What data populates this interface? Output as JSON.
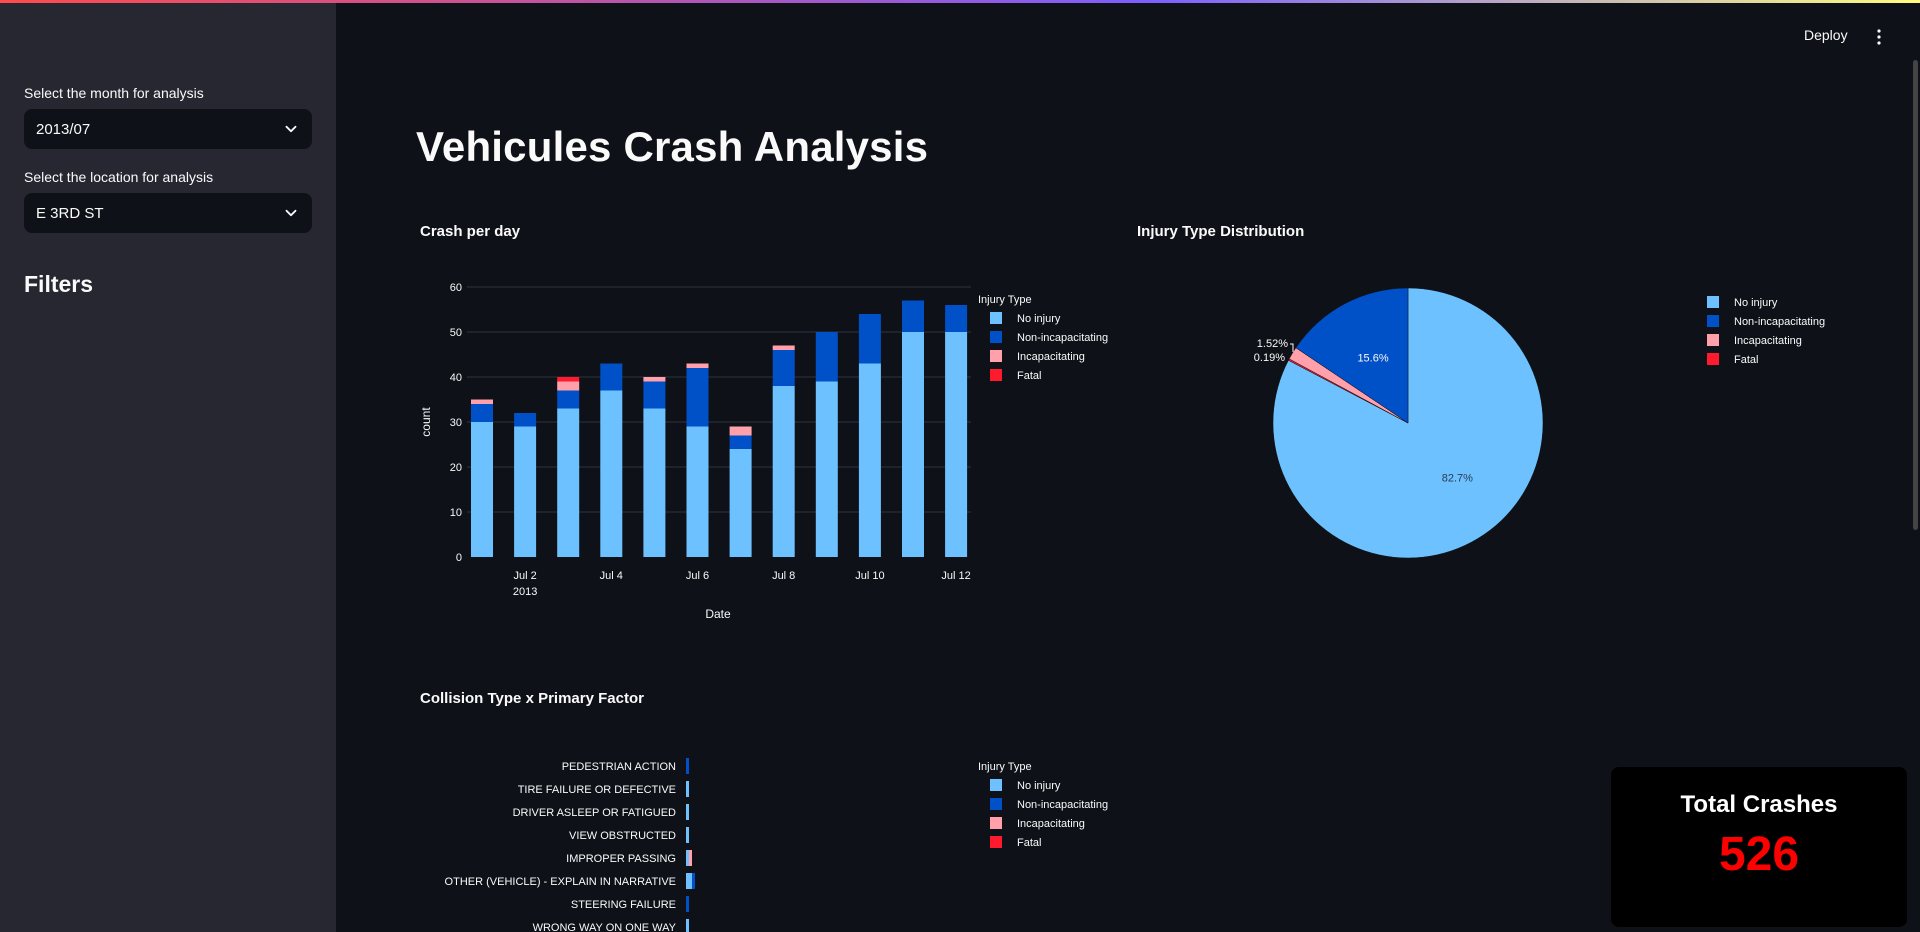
{
  "sidebar": {
    "month_label": "Select the month for analysis",
    "month_value": "2013/07",
    "location_label": "Select the location for analysis",
    "location_value": "E 3RD ST",
    "filters_heading": "Filters"
  },
  "header": {
    "deploy_label": "Deploy"
  },
  "main": {
    "title": "Vehicules Crash Analysis"
  },
  "colors": {
    "no_injury": "#6ec1ff",
    "non_incapacitating": "#0050c8",
    "incapacitating": "#ffa0aa",
    "fatal": "#ff1a2e",
    "total_value": "#ff0000"
  },
  "legend": {
    "title": "Injury Type",
    "items": [
      "No injury",
      "Non-incapacitating",
      "Incapacitating",
      "Fatal"
    ]
  },
  "chart_data": [
    {
      "type": "bar",
      "title": "Crash per day",
      "xlabel": "Date",
      "ylabel": "count",
      "ylim": [
        0,
        60
      ],
      "yticks": [
        0,
        10,
        20,
        30,
        40,
        50,
        60
      ],
      "xticks": [
        {
          "label": "Jul 2",
          "sub": "2013",
          "at": 2
        },
        {
          "label": "Jul 4",
          "sub": "",
          "at": 4
        },
        {
          "label": "Jul 6",
          "sub": "",
          "at": 6
        },
        {
          "label": "Jul 8",
          "sub": "",
          "at": 8
        },
        {
          "label": "Jul 10",
          "sub": "",
          "at": 10
        },
        {
          "label": "Jul 12",
          "sub": "",
          "at": 12
        }
      ],
      "categories": [
        "Jul 1",
        "Jul 2",
        "Jul 3",
        "Jul 4",
        "Jul 5",
        "Jul 6",
        "Jul 7",
        "Jul 8",
        "Jul 9",
        "Jul 10",
        "Jul 11",
        "Jul 12"
      ],
      "stacked": true,
      "series": [
        {
          "name": "No injury",
          "values": [
            30,
            29,
            33,
            37,
            33,
            29,
            24,
            38,
            39,
            43,
            50,
            50
          ]
        },
        {
          "name": "Non-incapacitating",
          "values": [
            4,
            3,
            4,
            6,
            6,
            13,
            3,
            8,
            11,
            11,
            7,
            6
          ]
        },
        {
          "name": "Incapacitating",
          "values": [
            1,
            0,
            2,
            0,
            1,
            1,
            2,
            1,
            0,
            0,
            0,
            0
          ]
        },
        {
          "name": "Fatal",
          "values": [
            0,
            0,
            1,
            0,
            0,
            0,
            0,
            0,
            0,
            0,
            0,
            0
          ]
        }
      ],
      "grid": true,
      "legend_position": "right"
    },
    {
      "type": "pie",
      "title": "Injury Type Distribution",
      "labels": [
        "No injury",
        "Non-incapacitating",
        "Incapacitating",
        "Fatal"
      ],
      "values": [
        82.7,
        15.6,
        1.52,
        0.19
      ],
      "value_labels": [
        "82.7%",
        "15.6%",
        "1.52%",
        "0.19%"
      ],
      "legend_position": "right"
    },
    {
      "type": "bar",
      "orientation": "horizontal",
      "title": "Collision Type x Primary Factor",
      "stacked": true,
      "categories": [
        "PEDESTRIAN ACTION",
        "TIRE FAILURE OR DEFECTIVE",
        "DRIVER ASLEEP OR FATIGUED",
        "VIEW OBSTRUCTED",
        "IMPROPER PASSING",
        "OTHER (VEHICLE) - EXPLAIN IN NARRATIVE",
        "STEERING FAILURE",
        "WRONG WAY ON ONE WAY"
      ],
      "series": [
        {
          "name": "No injury",
          "values": [
            0,
            1,
            1,
            1,
            1,
            2,
            0,
            1
          ]
        },
        {
          "name": "Non-incapacitating",
          "values": [
            1,
            0,
            0,
            0,
            0,
            1,
            1,
            0
          ]
        },
        {
          "name": "Incapacitating",
          "values": [
            0,
            0,
            0,
            0,
            1,
            0,
            0,
            0
          ]
        },
        {
          "name": "Fatal",
          "values": [
            0,
            0,
            0,
            0,
            0,
            0,
            0,
            0
          ]
        }
      ],
      "legend_position": "right"
    }
  ],
  "total": {
    "label": "Total Crashes",
    "value": "526"
  }
}
